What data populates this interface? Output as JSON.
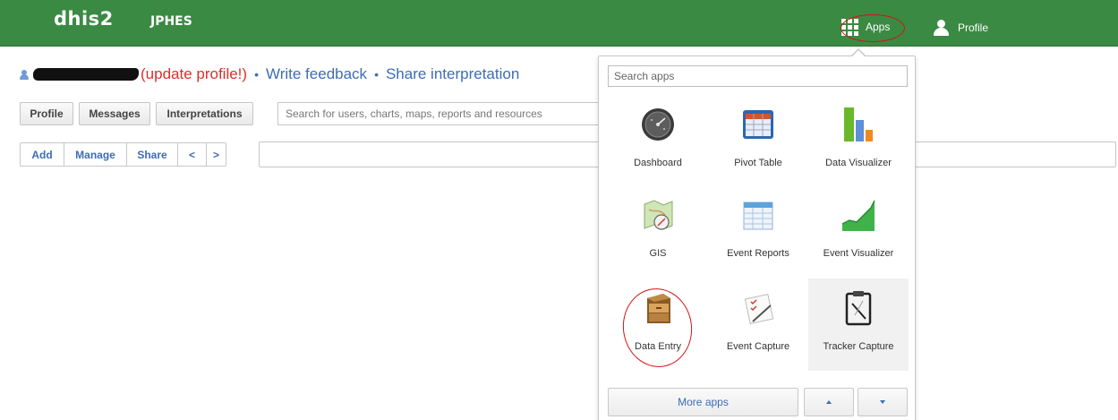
{
  "header": {
    "logo": "dhis2",
    "org_unit": "JPHES",
    "apps_label": "Apps",
    "profile_label": "Profile"
  },
  "greeting": {
    "update_profile": "(update profile!)",
    "separator": "•",
    "write_feedback": "Write feedback",
    "share_interpretation": "Share interpretation"
  },
  "tabs": {
    "profile": "Profile",
    "messages": "Messages",
    "interpretations": "Interpretations",
    "search_placeholder": "Search for users, charts, maps, reports and resources"
  },
  "dashboard_toolbar": {
    "add": "Add",
    "manage": "Manage",
    "share": "Share",
    "prev": "<",
    "next": ">"
  },
  "apps_menu": {
    "search_placeholder": "Search apps",
    "apps": [
      {
        "label": "Dashboard",
        "icon": "dashboard-icon"
      },
      {
        "label": "Pivot Table",
        "icon": "pivot-table-icon"
      },
      {
        "label": "Data Visualizer",
        "icon": "data-visualizer-icon"
      },
      {
        "label": "GIS",
        "icon": "gis-icon"
      },
      {
        "label": "Event Reports",
        "icon": "event-reports-icon"
      },
      {
        "label": "Event Visualizer",
        "icon": "event-visualizer-icon"
      },
      {
        "label": "Data Entry",
        "icon": "data-entry-icon"
      },
      {
        "label": "Event Capture",
        "icon": "event-capture-icon"
      },
      {
        "label": "Tracker Capture",
        "icon": "tracker-capture-icon"
      }
    ],
    "more_apps": "More apps"
  },
  "colors": {
    "header_bg": "#3b8a43",
    "link": "#3d6cb6",
    "alert": "#d8302b",
    "annotation": "#d01515"
  }
}
